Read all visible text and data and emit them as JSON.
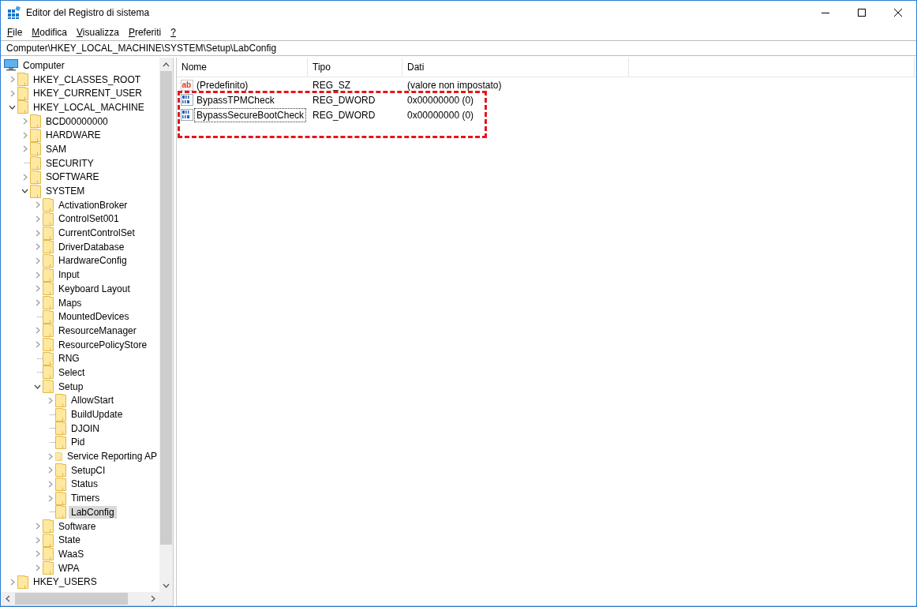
{
  "window": {
    "title": "Editor del Registro di sistema"
  },
  "menu": [
    {
      "label": "File"
    },
    {
      "label": "Modifica"
    },
    {
      "label": "Visualizza"
    },
    {
      "label": "Preferiti"
    },
    {
      "label": "?"
    }
  ],
  "address": {
    "value": "Computer\\HKEY_LOCAL_MACHINE\\SYSTEM\\Setup\\LabConfig"
  },
  "tree": [
    {
      "label": "Computer",
      "kind": "root",
      "selected": false,
      "children": [
        {
          "label": "HKEY_CLASSES_ROOT",
          "kind": "collapsed",
          "selected": false
        },
        {
          "label": "HKEY_CURRENT_USER",
          "kind": "collapsed",
          "selected": false
        },
        {
          "label": "HKEY_LOCAL_MACHINE",
          "kind": "expanded",
          "selected": false,
          "children": [
            {
              "label": "BCD00000000",
              "kind": "collapsed",
              "selected": false
            },
            {
              "label": "HARDWARE",
              "kind": "collapsed",
              "selected": false
            },
            {
              "label": "SAM",
              "kind": "collapsed",
              "selected": false
            },
            {
              "label": "SECURITY",
              "kind": "leaf",
              "selected": false
            },
            {
              "label": "SOFTWARE",
              "kind": "collapsed",
              "selected": false
            },
            {
              "label": "SYSTEM",
              "kind": "expanded",
              "selected": false,
              "children": [
                {
                  "label": "ActivationBroker",
                  "kind": "collapsed",
                  "selected": false
                },
                {
                  "label": "ControlSet001",
                  "kind": "collapsed",
                  "selected": false
                },
                {
                  "label": "CurrentControlSet",
                  "kind": "collapsed",
                  "selected": false
                },
                {
                  "label": "DriverDatabase",
                  "kind": "collapsed",
                  "selected": false
                },
                {
                  "label": "HardwareConfig",
                  "kind": "collapsed",
                  "selected": false
                },
                {
                  "label": "Input",
                  "kind": "collapsed",
                  "selected": false
                },
                {
                  "label": "Keyboard Layout",
                  "kind": "collapsed",
                  "selected": false
                },
                {
                  "label": "Maps",
                  "kind": "collapsed",
                  "selected": false
                },
                {
                  "label": "MountedDevices",
                  "kind": "leaf",
                  "selected": false
                },
                {
                  "label": "ResourceManager",
                  "kind": "collapsed",
                  "selected": false
                },
                {
                  "label": "ResourcePolicyStore",
                  "kind": "collapsed",
                  "selected": false
                },
                {
                  "label": "RNG",
                  "kind": "leaf",
                  "selected": false
                },
                {
                  "label": "Select",
                  "kind": "leaf",
                  "selected": false
                },
                {
                  "label": "Setup",
                  "kind": "expanded",
                  "selected": false,
                  "children": [
                    {
                      "label": "AllowStart",
                      "kind": "collapsed",
                      "selected": false
                    },
                    {
                      "label": "BuildUpdate",
                      "kind": "leaf",
                      "selected": false
                    },
                    {
                      "label": "DJOIN",
                      "kind": "leaf",
                      "selected": false
                    },
                    {
                      "label": "Pid",
                      "kind": "leaf",
                      "selected": false
                    },
                    {
                      "label": "Service Reporting AP",
                      "kind": "collapsed",
                      "selected": false
                    },
                    {
                      "label": "SetupCI",
                      "kind": "collapsed",
                      "selected": false
                    },
                    {
                      "label": "Status",
                      "kind": "collapsed",
                      "selected": false
                    },
                    {
                      "label": "Timers",
                      "kind": "collapsed",
                      "selected": false
                    },
                    {
                      "label": "LabConfig",
                      "kind": "leaf",
                      "selected": true
                    }
                  ]
                },
                {
                  "label": "Software",
                  "kind": "collapsed",
                  "selected": false
                },
                {
                  "label": "State",
                  "kind": "collapsed",
                  "selected": false
                },
                {
                  "label": "WaaS",
                  "kind": "collapsed",
                  "selected": false
                },
                {
                  "label": "WPA",
                  "kind": "collapsed",
                  "selected": false
                }
              ]
            }
          ]
        },
        {
          "label": "HKEY_USERS",
          "kind": "collapsed",
          "selected": false
        }
      ]
    }
  ],
  "table": {
    "columns": [
      "Nome",
      "Tipo",
      "Dati"
    ],
    "rows": [
      {
        "kind": "string",
        "icon": "ab",
        "name": "(Predefinito)",
        "type": "REG_SZ",
        "data": "(valore non impostato)",
        "focused": false,
        "highlighted": false
      },
      {
        "kind": "binary",
        "name": "BypassTPMCheck",
        "type": "REG_DWORD",
        "data": "0x00000000 (0)",
        "focused": false,
        "highlighted": true
      },
      {
        "kind": "binary",
        "name": "BypassSecureBootCheck",
        "type": "REG_DWORD",
        "data": "0x00000000 (0)",
        "focused": true,
        "highlighted": true
      }
    ]
  }
}
